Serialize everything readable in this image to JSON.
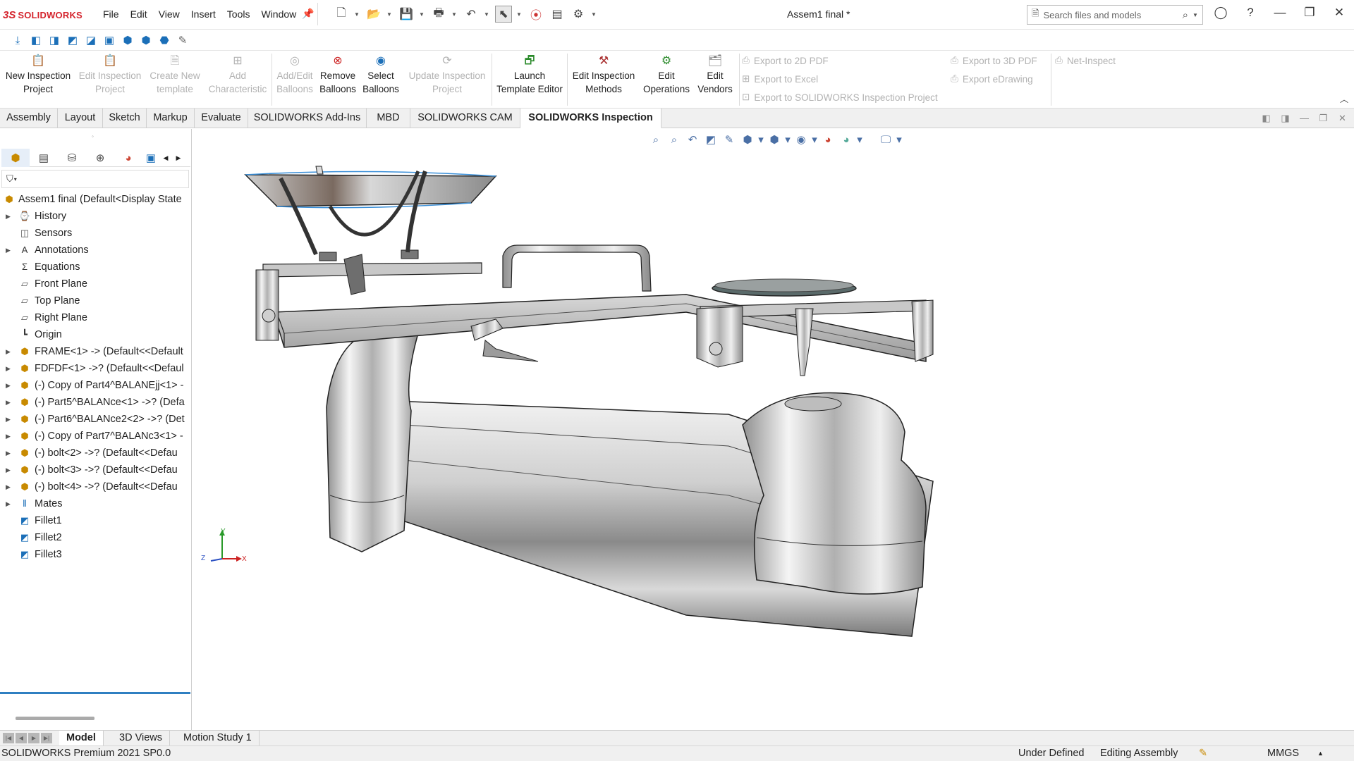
{
  "app": {
    "logo_ds": "3S",
    "logo_text": "SOLIDWORKS",
    "doc_title": "Assem1 final *"
  },
  "menu": [
    "File",
    "Edit",
    "View",
    "Insert",
    "Tools",
    "Window"
  ],
  "search": {
    "placeholder": "Search files and models"
  },
  "ribbon": {
    "new_inspection_project": [
      "New Inspection",
      "Project"
    ],
    "edit_inspection_project": [
      "Edit Inspection",
      "Project"
    ],
    "create_new_template": [
      "Create New",
      "template"
    ],
    "add_characteristic": [
      "Add",
      "Characteristic"
    ],
    "add_edit_balloons": [
      "Add/Edit",
      "Balloons"
    ],
    "remove_balloons": [
      "Remove",
      "Balloons"
    ],
    "select_balloons": [
      "Select",
      "Balloons"
    ],
    "update_inspection_project": [
      "Update Inspection",
      "Project"
    ],
    "launch_template_editor": [
      "Launch",
      "Template Editor"
    ],
    "edit_inspection_methods": [
      "Edit Inspection",
      "Methods"
    ],
    "edit_operations": [
      "Edit",
      "Operations"
    ],
    "edit_vendors": [
      "Edit",
      "Vendors"
    ],
    "export_2d_pdf": "Export to 2D PDF",
    "export_excel": "Export to Excel",
    "export_sw_inspection": "Export to SOLIDWORKS Inspection Project",
    "export_3d_pdf": "Export to 3D PDF",
    "export_edrawing": "Export eDrawing",
    "net_inspect": "Net-Inspect"
  },
  "tabs": [
    "Assembly",
    "Layout",
    "Sketch",
    "Markup",
    "Evaluate",
    "SOLIDWORKS Add-Ins",
    "MBD",
    "SOLIDWORKS CAM",
    "SOLIDWORKS Inspection"
  ],
  "active_tab": "SOLIDWORKS Inspection",
  "tree": {
    "root": "Assem1 final  (Default<Display State",
    "items": [
      {
        "label": "History",
        "expandable": true,
        "icon": "history-icon"
      },
      {
        "label": "Sensors",
        "expandable": false,
        "icon": "sensors-icon"
      },
      {
        "label": "Annotations",
        "expandable": true,
        "icon": "annotations-icon"
      },
      {
        "label": "Equations",
        "expandable": false,
        "icon": "equations-icon"
      },
      {
        "label": "Front Plane",
        "expandable": false,
        "icon": "plane-icon"
      },
      {
        "label": "Top Plane",
        "expandable": false,
        "icon": "plane-icon"
      },
      {
        "label": "Right Plane",
        "expandable": false,
        "icon": "plane-icon"
      },
      {
        "label": "Origin",
        "expandable": false,
        "icon": "origin-icon"
      },
      {
        "label": "FRAME<1> -> (Default<<Default",
        "expandable": true,
        "icon": "part-icon"
      },
      {
        "label": "FDFDF<1> ->? (Default<<Defaul",
        "expandable": true,
        "icon": "part-icon"
      },
      {
        "label": "(-) Copy of Part4^BALANEjj<1> -",
        "expandable": true,
        "icon": "part-icon"
      },
      {
        "label": "(-) Part5^BALANce<1> ->? (Defa",
        "expandable": true,
        "icon": "part-icon"
      },
      {
        "label": "(-) Part6^BALANce2<2> ->? (Det",
        "expandable": true,
        "icon": "part-icon"
      },
      {
        "label": "(-) Copy of Part7^BALANc3<1> -",
        "expandable": true,
        "icon": "part-icon"
      },
      {
        "label": "(-) bolt<2> ->? (Default<<Defau",
        "expandable": true,
        "icon": "part-icon"
      },
      {
        "label": "(-) bolt<3> ->? (Default<<Defau",
        "expandable": true,
        "icon": "part-icon"
      },
      {
        "label": "(-) bolt<4> ->? (Default<<Defau",
        "expandable": true,
        "icon": "part-icon"
      },
      {
        "label": "Mates",
        "expandable": true,
        "icon": "mates-icon"
      },
      {
        "label": "Fillet1",
        "expandable": false,
        "icon": "fillet-icon"
      },
      {
        "label": "Fillet2",
        "expandable": false,
        "icon": "fillet-icon"
      },
      {
        "label": "Fillet3",
        "expandable": false,
        "icon": "fillet-icon"
      }
    ]
  },
  "triad": {
    "y": "Y",
    "z": "Z",
    "x": "X"
  },
  "bottom_tabs": [
    "Model",
    "3D Views",
    "Motion Study 1"
  ],
  "status": {
    "product": "SOLIDWORKS Premium 2021 SP0.0",
    "state": "Under Defined",
    "mode": "Editing Assembly",
    "units": "MMGS"
  }
}
